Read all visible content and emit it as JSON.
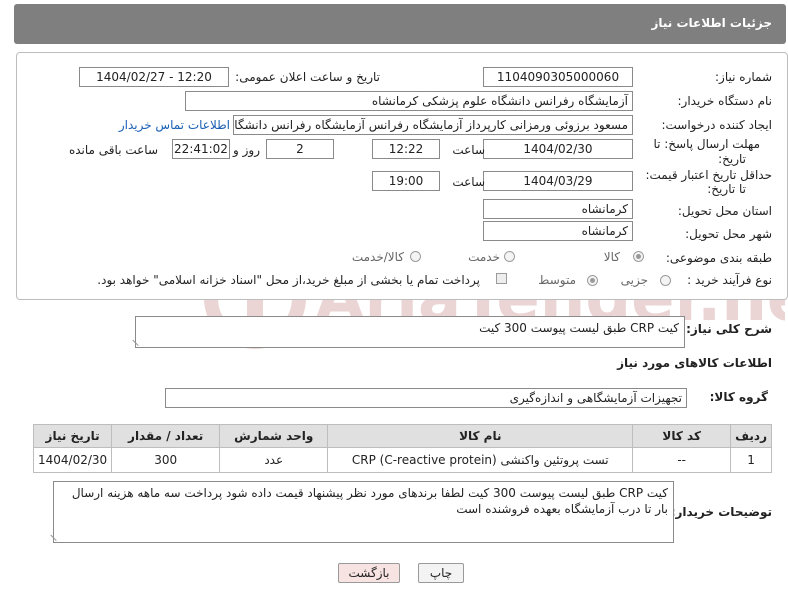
{
  "header": {
    "title": "جزئیات اطلاعات نیاز"
  },
  "form": {
    "need_number": {
      "label": "شماره نیاز:",
      "value": "1104090305000060"
    },
    "announce_datetime": {
      "label": "تاریخ و ساعت اعلان عمومی:",
      "value": "1404/02/27 - 12:20"
    },
    "buyer_org": {
      "label": "نام دستگاه خریدار:",
      "value": "آزمایشگاه رفرانس دانشگاه علوم پزشکی کرمانشاه"
    },
    "requester": {
      "label": "ایجاد کننده درخواست:",
      "value": "مسعود برزوئی ورمزانی کارپرداز آزمایشگاه رفرانس آزمایشگاه رفرانس دانشگاه ع",
      "contact_link": "اطلاعات تماس خریدار"
    },
    "reply_deadline": {
      "label_line1": "مهلت ارسال پاسخ: تا",
      "label_line2": "تاریخ:",
      "date": "1404/02/30",
      "time_label": "ساعت",
      "time": "12:22",
      "days": "2",
      "days_label": "روز و",
      "remaining": "22:41:02",
      "remaining_label": "ساعت باقی مانده"
    },
    "price_validity": {
      "label_line1": "حداقل تاریخ اعتبار قیمت:",
      "label_line2": "تا تاریخ:",
      "date": "1404/03/29",
      "time_label": "ساعت",
      "time": "19:00"
    },
    "delivery_province": {
      "label": "استان محل تحویل:",
      "value": "کرمانشاه"
    },
    "delivery_city": {
      "label": "شهر محل تحویل:",
      "value": "کرمانشاه"
    },
    "category": {
      "label": "طبقه بندی موضوعی:",
      "options": [
        "کالا",
        "خدمت",
        "کالا/خدمت"
      ],
      "selected": "کالا"
    },
    "purchase_type": {
      "label": "نوع فرآیند خرید :",
      "options": [
        "جزیی",
        "متوسط"
      ],
      "selected": "متوسط",
      "note": "پرداخت تمام یا بخشی از مبلغ خرید،از محل \"اسناد خزانه اسلامی\" خواهد بود."
    }
  },
  "description": {
    "label": "شرح کلی نیاز:",
    "value": "کیت CRP طبق لیست پیوست 300 کیت"
  },
  "goods_section": {
    "title": "اطلاعات کالاهای مورد نیاز"
  },
  "goods_group": {
    "label": "گروه کالا:",
    "value": "تجهیزات آزمایشگاهی و اندازه‌گیری"
  },
  "table": {
    "headers": [
      "ردیف",
      "کد کالا",
      "نام کالا",
      "واحد شمارش",
      "تعداد / مقدار",
      "تاریخ نیاز"
    ],
    "rows": [
      [
        "1",
        "--",
        "تست پروتئین واکنشی (C-reactive protein) CRP",
        "عدد",
        "300",
        "1404/02/30"
      ]
    ]
  },
  "buyer_notes": {
    "label": "توضیحات خریدار:",
    "value": "کیت CRP طبق لیست پیوست 300 کیت لطفا برندهای مورد نظر پیشنهاد قیمت داده شود پرداخت سه ماهه هزینه ارسال بار تا درب آزمایشگاه بعهده فروشنده است"
  },
  "buttons": {
    "print": "چاپ",
    "back": "بازگشت"
  },
  "watermark": {
    "text": "AriaTender.neT"
  },
  "colors": {
    "title_bar": "#7f7f7f",
    "link": "#1a5fb4",
    "watermark": "#e8c9c9"
  }
}
